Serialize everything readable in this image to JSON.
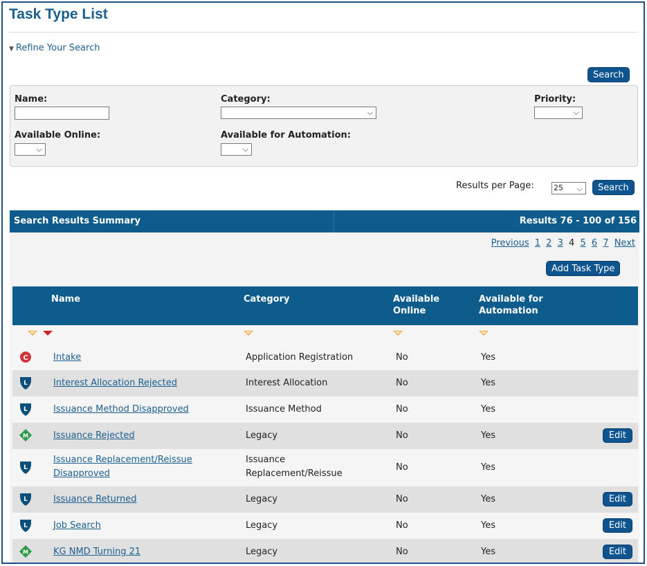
{
  "page": {
    "title": "Task Type List",
    "refine_label": "Refine Your Search"
  },
  "search": {
    "top_button": "Search",
    "name_label": "Name:",
    "name_value": "",
    "category_label": "Category:",
    "category_value": "",
    "priority_label": "Priority:",
    "priority_value": "",
    "available_online_label": "Available Online:",
    "available_online_value": "",
    "available_automation_label": "Available for Automation:",
    "available_automation_value": ""
  },
  "results": {
    "per_page_label": "Results per Page:",
    "per_page_value": "25",
    "search_button": "Search",
    "summary_title": "Search Results Summary",
    "summary_range": "Results 76 - 100 of 156",
    "add_button": "Add Task Type"
  },
  "pager": {
    "previous": "Previous",
    "pages": [
      "1",
      "2",
      "3",
      "4",
      "5",
      "6",
      "7"
    ],
    "current": "4",
    "next": "Next"
  },
  "table": {
    "headers": {
      "name": "Name",
      "category": "Category",
      "online_line1": "Available",
      "online_line2": "Online",
      "automation_line1": "Available for",
      "automation_line2": "Automation"
    },
    "edit_label": "Edit",
    "rows": [
      {
        "icon": "circle-c-icon",
        "name": "Intake",
        "category": "Application Registration",
        "online": "No",
        "automation": "Yes",
        "edit": false
      },
      {
        "icon": "shield-l-icon",
        "name": "Interest Allocation Rejected",
        "category": "Interest Allocation",
        "online": "No",
        "automation": "Yes",
        "edit": false
      },
      {
        "icon": "shield-l-icon",
        "name": "Issuance Method Disapproved",
        "category": "Issuance Method",
        "online": "No",
        "automation": "Yes",
        "edit": false
      },
      {
        "icon": "diamond-m-icon",
        "name": "Issuance Rejected",
        "category": "Legacy",
        "online": "No",
        "automation": "Yes",
        "edit": true
      },
      {
        "icon": "shield-l-icon",
        "name_line1": "Issuance Replacement/Reissue",
        "name_line2": "Disapproved",
        "category_line1": "Issuance",
        "category_line2": "Replacement/Reissue",
        "online": "No",
        "automation": "Yes",
        "edit": false
      },
      {
        "icon": "shield-l-icon",
        "name": "Issuance Returned",
        "category": "Legacy",
        "online": "No",
        "automation": "Yes",
        "edit": true
      },
      {
        "icon": "shield-l-icon",
        "name": "Job Search",
        "category": "Legacy",
        "online": "No",
        "automation": "Yes",
        "edit": true
      },
      {
        "icon": "diamond-m-icon",
        "name": "KG NMD Turning 21",
        "category": "Legacy",
        "online": "No",
        "automation": "Yes",
        "edit": true
      }
    ]
  },
  "colors": {
    "header_blue": "#0d5c8c",
    "button_blue": "#0e5590",
    "link_blue": "#1b5f8f",
    "sort_orange": "#f2a23a",
    "sort_red": "#d02020"
  }
}
